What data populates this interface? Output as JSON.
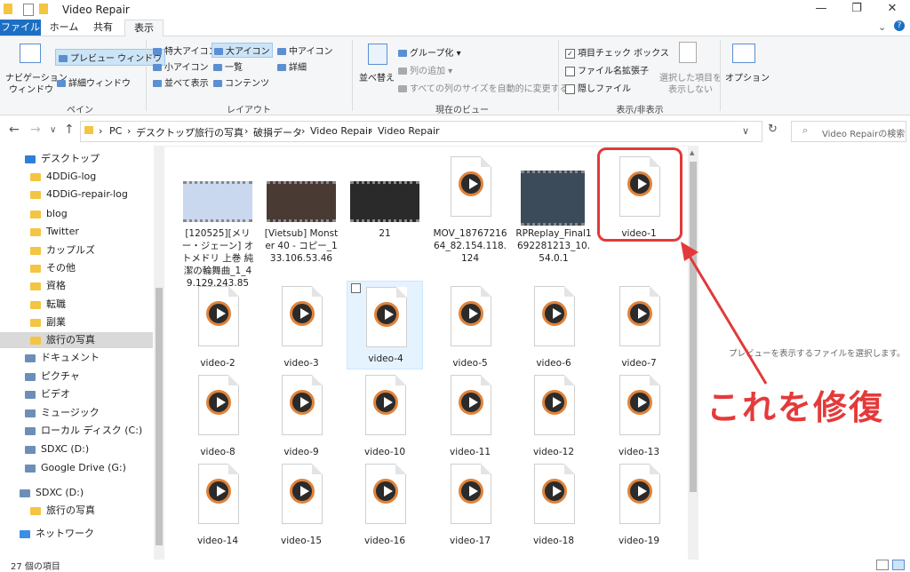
{
  "window": {
    "title": "Video Repair",
    "minimize": "—",
    "maximize": "❐",
    "close": "✕"
  },
  "tabs": [
    "ファイル",
    "ホーム",
    "共有",
    "表示"
  ],
  "ribbon": {
    "pane": {
      "nav_pane": "ナビゲーション",
      "nav_pane2": "ウィンドウ",
      "preview_pane": "プレビュー ウィンドウ",
      "details_pane": "詳細ウィンドウ",
      "label": "ペイン"
    },
    "layout": {
      "xl": "特大アイコン",
      "large": "大アイコン",
      "medium": "中アイコン",
      "small": "小アイコン",
      "list": "一覧",
      "details": "詳細",
      "tiles": "並べて表示",
      "content": "コンテンツ",
      "label": "レイアウト"
    },
    "view": {
      "sort": "並べ替え",
      "group": "グループ化",
      "addcol": "列の追加",
      "fit": "すべての列のサイズを自動的に変更する",
      "label": "現在のビュー"
    },
    "showhide": {
      "item_check": "項目チェック ボックス",
      "ext": "ファイル名拡張子",
      "hidden": "隠しファイル",
      "hide_sel": "選択した項目を",
      "hide_sel2": "表示しない",
      "label": "表示/非表示"
    },
    "options": "オプション"
  },
  "address": {
    "crumbs": [
      "PC",
      "デスクトップ",
      "旅行の写真",
      "破損データ",
      "Video Repair",
      "Video Repair"
    ],
    "search_placeholder": "Video Repairの検索"
  },
  "sidebar": [
    "デスクトップ",
    "4DDiG-log",
    "4DDiG-repair-log",
    "blog",
    "Twitter",
    "カップルズ",
    "その他",
    "資格",
    "転職",
    "副業",
    "旅行の写真",
    "ドキュメント",
    "ピクチャ",
    "ビデオ",
    "ミュージック",
    "ローカル ディスク (C:)",
    "SDXC (D:)",
    "Google Drive (G:)",
    "SDXC (D:)",
    "旅行の写真",
    "ネットワーク"
  ],
  "files_row1": [
    "[120525][メリー・ジェーン] オトメドリ 上巻 純潔の輪舞曲_1_49.129.243.85",
    "[Vietsub] Monster 40 - コピー_133.106.53.46",
    "21",
    "MOV_1876721664_82.154.118.124",
    "RPReplay_Final1692281213_10.54.0.1",
    "video-1"
  ],
  "files_grid": [
    "video-2",
    "video-3",
    "video-4",
    "video-5",
    "video-6",
    "video-7",
    "video-8",
    "video-9",
    "video-10",
    "video-11",
    "video-12",
    "video-13",
    "video-14",
    "video-15",
    "video-16",
    "video-17",
    "video-18",
    "video-19"
  ],
  "preview_text": "プレビューを表示するファイルを選択します。",
  "annotation": "これを修復",
  "status": "27 個の項目",
  "colors": {
    "accent": "#1c6fc3",
    "callout": "#e23a3a"
  }
}
